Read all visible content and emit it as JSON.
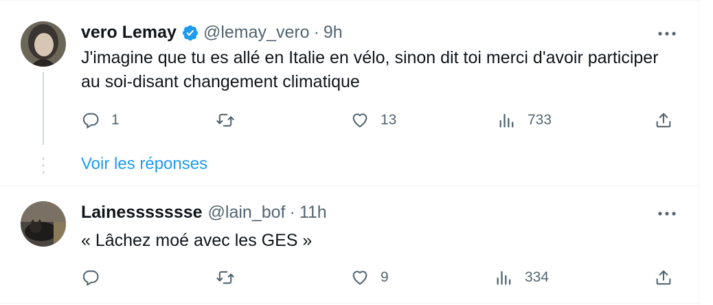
{
  "colors": {
    "accent": "#1d9bf0",
    "text": "#0f1419",
    "muted": "#536471",
    "divider": "#eff3f4"
  },
  "tweets": [
    {
      "avatar_icon": "user-avatar-photo",
      "name": "vero Lemay",
      "verified": true,
      "handle": "@lemay_vero",
      "separator": "·",
      "time": "9h",
      "text": "J'imagine que tu es allé en Italie en vélo, sinon dit toi merci d'avoir participer au soi-disant changement climatique",
      "replies": "1",
      "retweets": "",
      "likes": "13",
      "views": "733",
      "show_replies": "Voir les réponses"
    },
    {
      "avatar_icon": "user-avatar-photo",
      "name": "Lainessssssse",
      "verified": false,
      "handle": "@lain_bof",
      "separator": "·",
      "time": "11h",
      "text": "« Lâchez moé avec les GES »",
      "replies": "",
      "retweets": "",
      "likes": "9",
      "views": "334"
    }
  ]
}
